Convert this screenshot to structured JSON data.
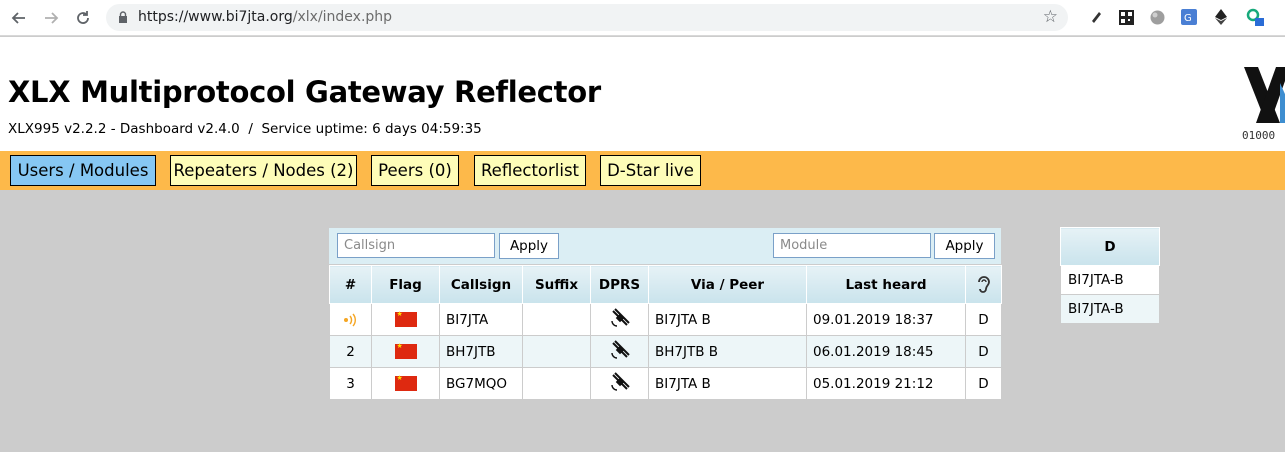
{
  "browser": {
    "url_host": "https://www.bi7jta.org",
    "url_path": "/xlx/index.php"
  },
  "header": {
    "title": "XLX Multiprotocol Gateway Reflector",
    "subtitle": "XLX995 v2.2.2 - Dashboard v2.4.0  /  Service uptime: 6 days 04:59:35",
    "logo_text": "01000"
  },
  "nav": {
    "tabs": [
      {
        "label": "Users / Modules",
        "active": true
      },
      {
        "label": "Repeaters / Nodes (2)",
        "active": false
      },
      {
        "label": "Peers (0)",
        "active": false
      },
      {
        "label": "Reflectorlist",
        "active": false
      },
      {
        "label": "D-Star live",
        "active": false
      }
    ]
  },
  "filters": {
    "callsign_placeholder": "Callsign",
    "module_placeholder": "Module",
    "apply_label": "Apply"
  },
  "table": {
    "headers": [
      "#",
      "Flag",
      "Callsign",
      "Suffix",
      "DPRS",
      "Via / Peer",
      "Last heard"
    ],
    "listen_icon": "ear-icon",
    "rows": [
      {
        "num": "",
        "flag": "china-flag-icon",
        "callsign": "BI7JTA",
        "suffix": "",
        "via": "BI7JTA B",
        "last_heard": "09.01.2019 18:37",
        "module": "D",
        "active": true
      },
      {
        "num": "2",
        "flag": "china-flag-icon",
        "callsign": "BH7JTB",
        "suffix": "",
        "via": "BH7JTB B",
        "last_heard": "06.01.2019 18:45",
        "module": "D",
        "active": false
      },
      {
        "num": "3",
        "flag": "china-flag-icon",
        "callsign": "BG7MQO",
        "suffix": "",
        "via": "BI7JTA B",
        "last_heard": "05.01.2019 21:12",
        "module": "D",
        "active": false
      }
    ]
  },
  "modules": {
    "header": "D",
    "items": [
      "BI7JTA-B",
      "BI7JTA-B"
    ]
  },
  "colors": {
    "nav_bg": "#fdb94a",
    "tab_bg": "#fefdb8",
    "tab_active_bg": "#86c7f3",
    "page_bg": "#cccccc"
  }
}
